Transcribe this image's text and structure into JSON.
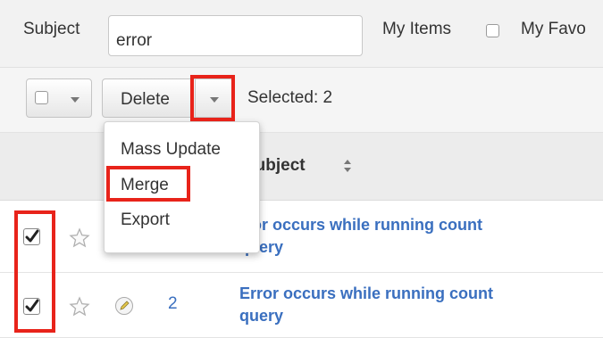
{
  "filter": {
    "subject_label": "Subject",
    "search_value": "error",
    "my_items_label": "My Items",
    "my_favorites_label": "My Favo"
  },
  "toolbar": {
    "delete_label": "Delete",
    "selected_text": "Selected: 2"
  },
  "table": {
    "subject_header": "Subject",
    "rows": [
      {
        "checked": true,
        "subject_visible": "rror occurs while running count",
        "subject_line2": "query"
      },
      {
        "checked": true,
        "number": "2",
        "subject_visible": "Error occurs while running count",
        "subject_line2": "query"
      }
    ]
  },
  "actions_menu": {
    "items": [
      "Mass Update",
      "Merge",
      "Export"
    ]
  },
  "highlight_color": "#e8231a",
  "link_color": "#3a6fbf"
}
